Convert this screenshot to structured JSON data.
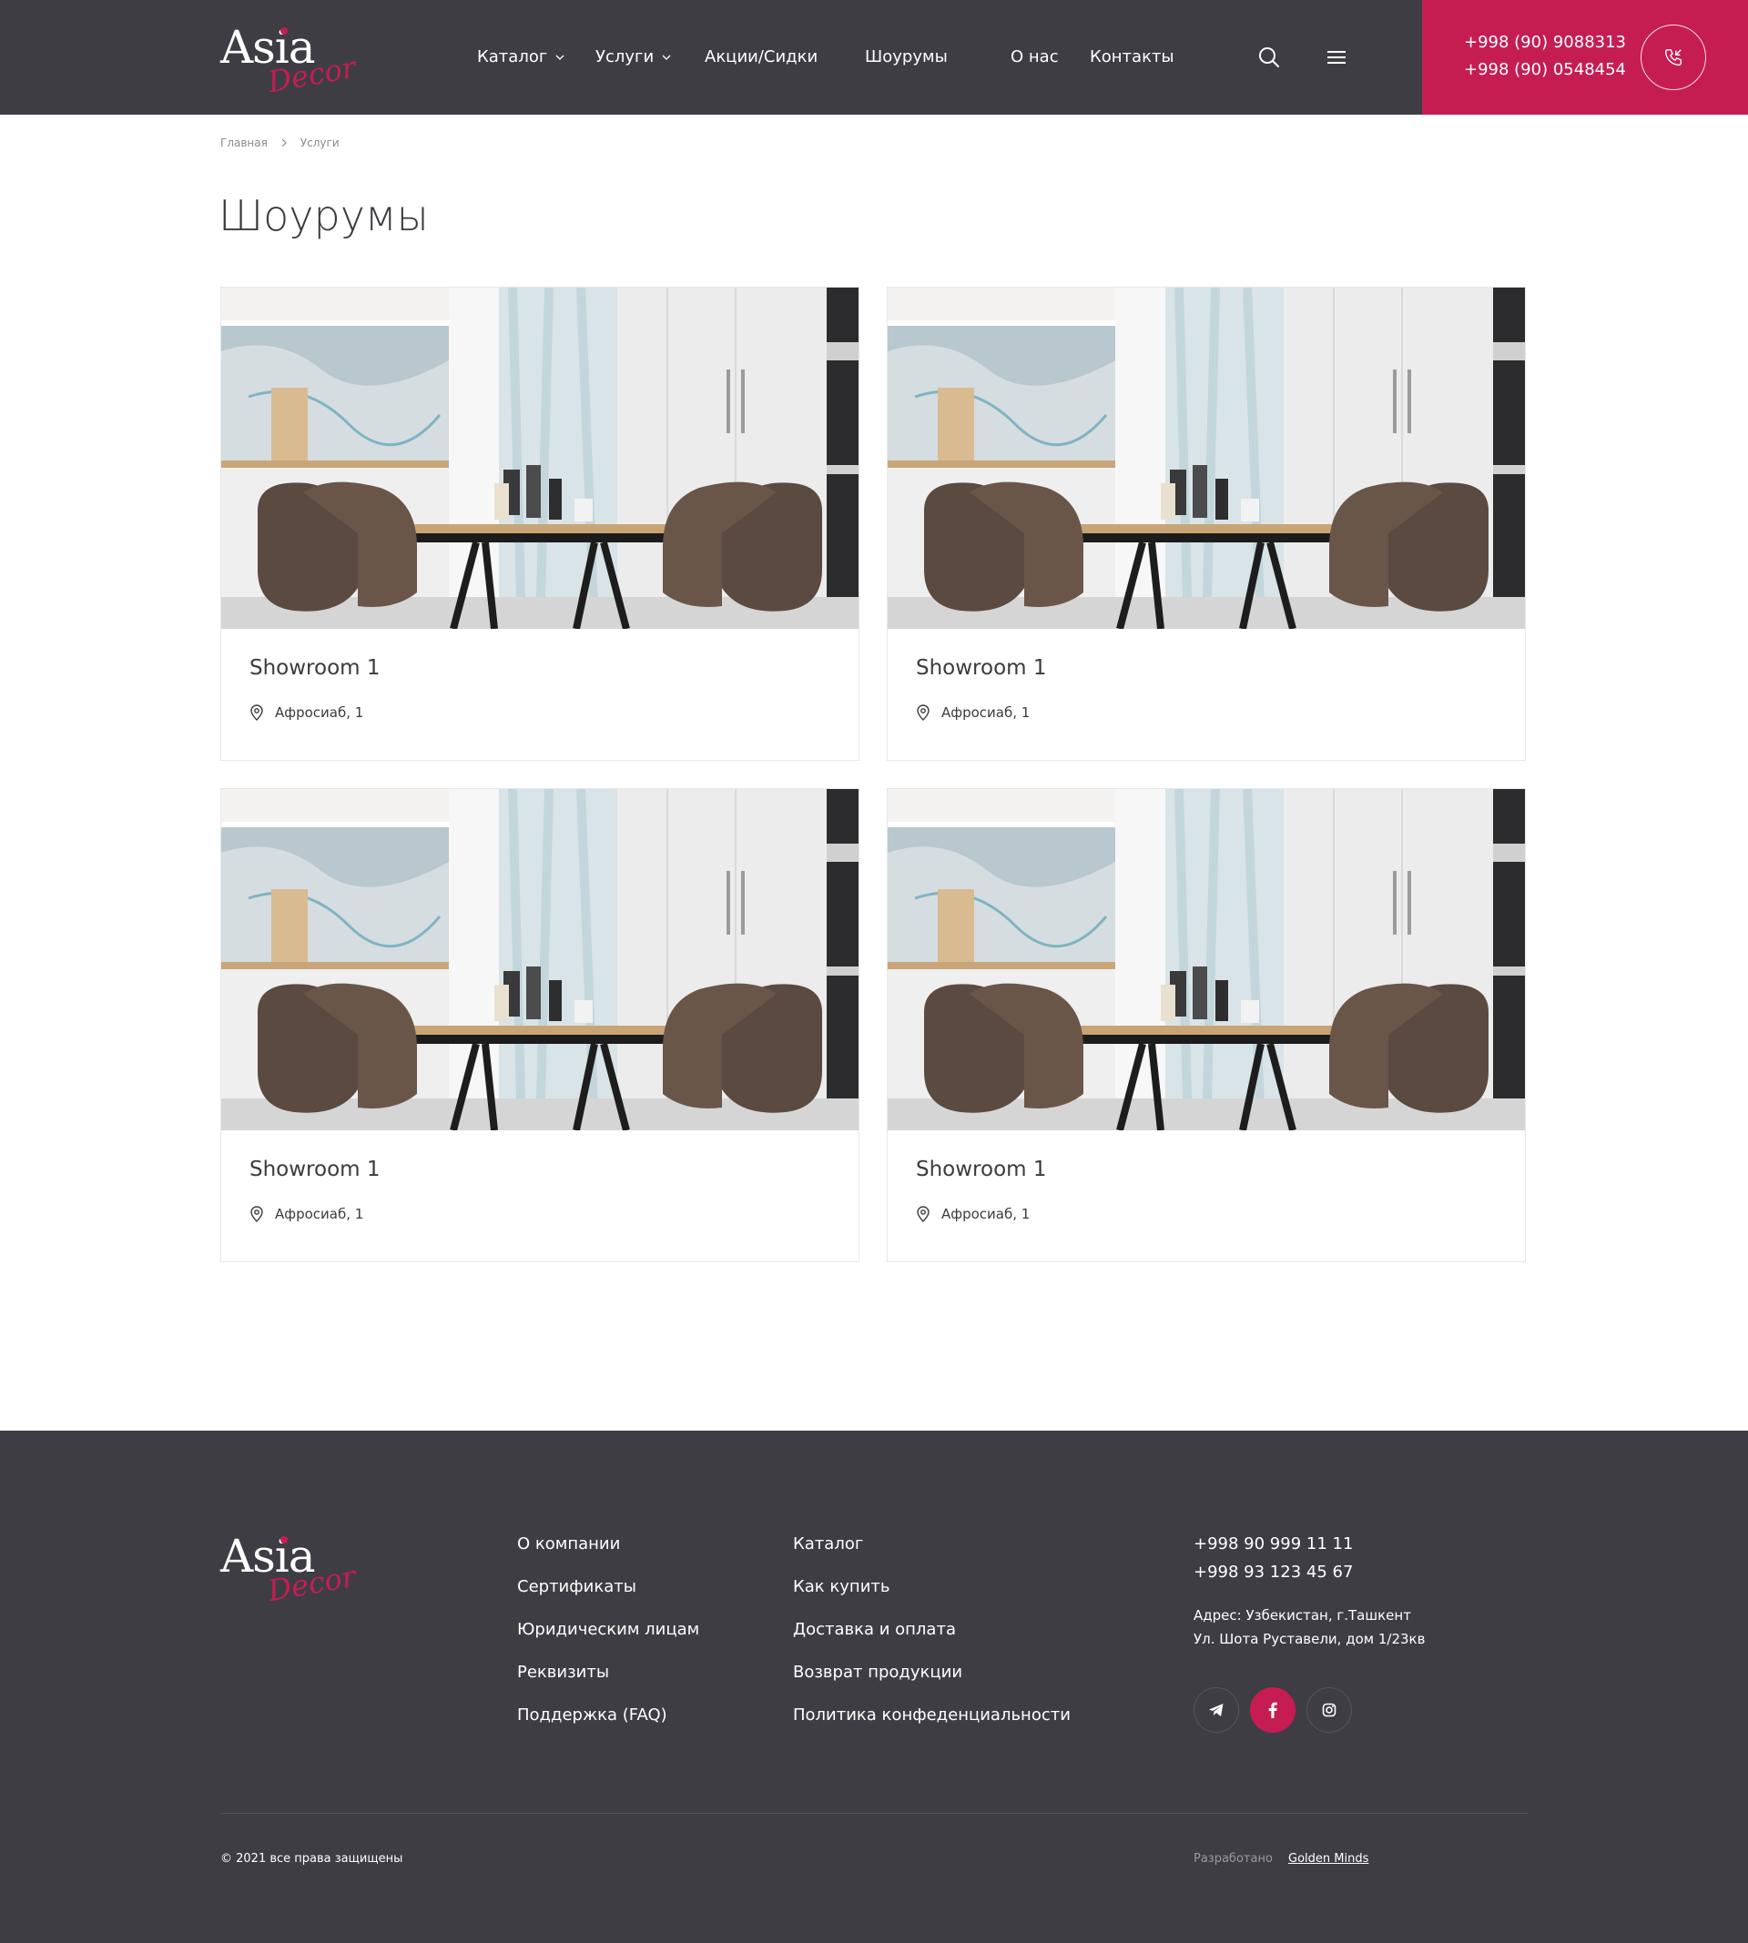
{
  "header": {
    "logo_main": "Asia",
    "logo_sub": "Decor",
    "nav": [
      {
        "label": "Каталог"
      },
      {
        "label": "Услуги"
      },
      {
        "label": "Акции/Сидки"
      },
      {
        "label": "Шоурумы"
      },
      {
        "label": "О нас"
      },
      {
        "label": "Контакты"
      }
    ],
    "phones": [
      "+998 (90) 9088313",
      "+998 (90) 0548454"
    ]
  },
  "breadcrumb": [
    "Главная",
    "Услуги"
  ],
  "page_title": "Шоурумы",
  "showrooms": [
    {
      "title": "Showroom 1",
      "address": "Афросиаб, 1"
    },
    {
      "title": "Showroom 1",
      "address": "Афросиаб, 1"
    },
    {
      "title": "Showroom 1",
      "address": "Афросиаб, 1"
    },
    {
      "title": "Showroom 1",
      "address": "Афросиаб, 1"
    }
  ],
  "footer": {
    "logo_main": "Asia",
    "logo_sub": "Decor",
    "col1": [
      "О компании",
      "Сертификаты",
      "Юридическим лицам",
      "Реквизиты",
      "Поддержка (FAQ)"
    ],
    "col2": [
      "Каталог",
      "Как купить",
      "Доставка и оплата",
      "Возврат продукции",
      "Политика конфеденциальности"
    ],
    "phones": [
      "+998 90 999 11 11",
      "+998 93 123 45 67"
    ],
    "address_line1": "Адрес: Узбекистан, г.Ташкент",
    "address_line2": "Ул. Шота Руставели, дом 1/23кв",
    "social": [
      "telegram-icon",
      "facebook-icon",
      "instagram-icon"
    ],
    "copyright": "© 2021 все права защищены",
    "dev_label": "Разработано",
    "dev_name": "Golden Minds"
  },
  "colors": {
    "dark": "#3e3d44",
    "accent": "#c51d52"
  }
}
